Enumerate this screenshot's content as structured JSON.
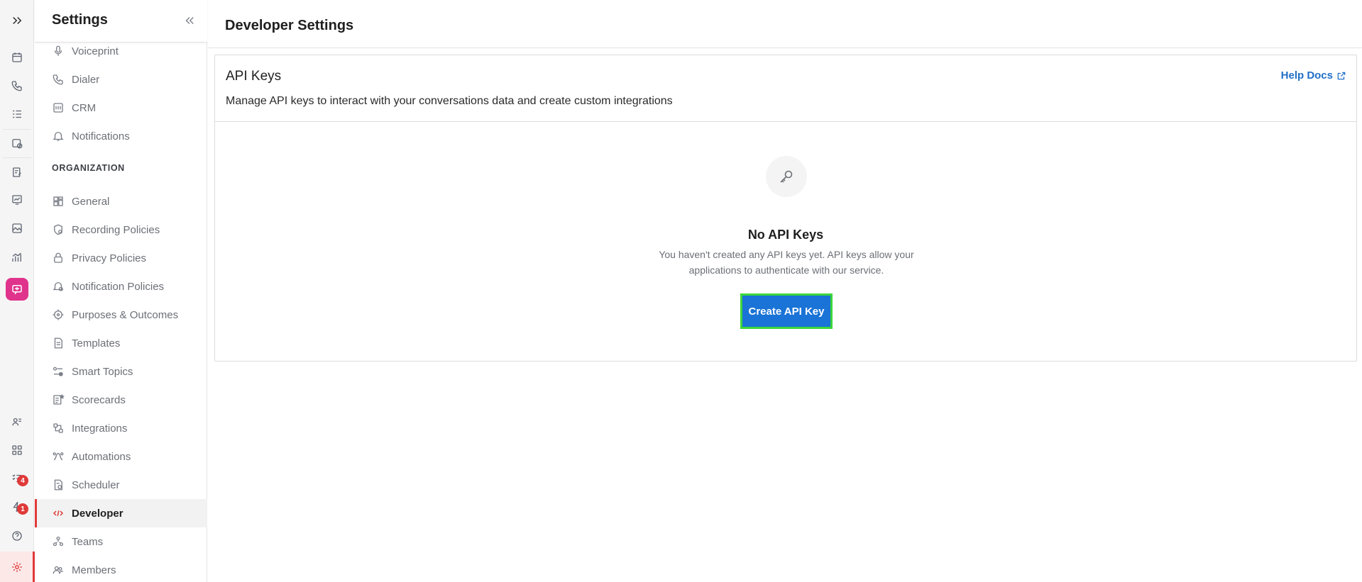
{
  "sidebar": {
    "title": "Settings",
    "section_label": "ORGANIZATION",
    "items": [
      {
        "label": "Voiceprint",
        "icon": "microphone-icon"
      },
      {
        "label": "Dialer",
        "icon": "phone-icon"
      },
      {
        "label": "CRM",
        "icon": "crm-icon"
      },
      {
        "label": "Notifications",
        "icon": "bell-icon"
      },
      {
        "label": "General",
        "icon": "grid-icon"
      },
      {
        "label": "Recording Policies",
        "icon": "recording-policy-icon"
      },
      {
        "label": "Privacy Policies",
        "icon": "lock-icon"
      },
      {
        "label": "Notification Policies",
        "icon": "notification-policy-icon"
      },
      {
        "label": "Purposes & Outcomes",
        "icon": "target-icon"
      },
      {
        "label": "Templates",
        "icon": "document-icon"
      },
      {
        "label": "Smart Topics",
        "icon": "topics-icon"
      },
      {
        "label": "Scorecards",
        "icon": "scorecard-icon"
      },
      {
        "label": "Integrations",
        "icon": "integrations-icon"
      },
      {
        "label": "Automations",
        "icon": "automation-icon"
      },
      {
        "label": "Scheduler",
        "icon": "scheduler-icon"
      },
      {
        "label": "Developer",
        "icon": "code-icon",
        "active": true
      },
      {
        "label": "Teams",
        "icon": "teams-icon"
      },
      {
        "label": "Members",
        "icon": "members-icon"
      }
    ]
  },
  "rail": {
    "badges": {
      "tasks": "4",
      "alerts": "1"
    }
  },
  "header": {
    "title": "Developer Settings"
  },
  "api_keys": {
    "title": "API Keys",
    "description": "Manage API keys to interact with your conversations data and create custom integrations",
    "help_link": "Help Docs",
    "empty_title": "No API Keys",
    "empty_text": "You haven't created any API keys yet. API keys allow your applications to authenticate with our service.",
    "create_button": "Create API Key"
  },
  "colors": {
    "accent": "#1a73d6",
    "active": "#e03a3a",
    "pink": "#e0338c",
    "highlight": "#3ad63a"
  }
}
